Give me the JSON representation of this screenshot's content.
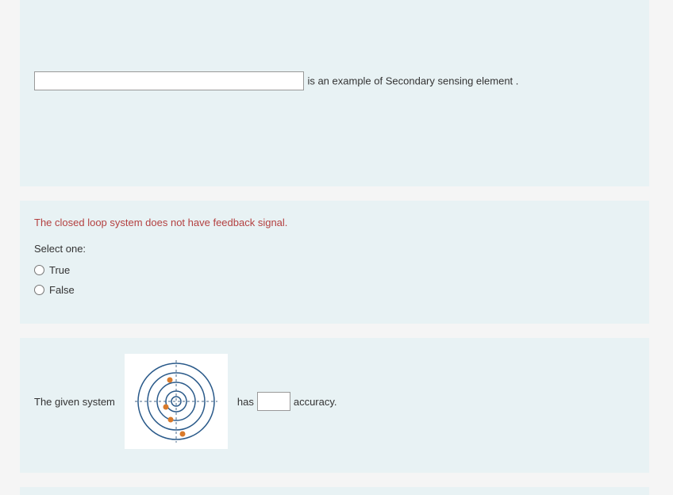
{
  "question1": {
    "suffix": " is an example of  Secondary sensing element ."
  },
  "question2": {
    "stem": "The closed loop system does not have feedback signal.",
    "prompt": "Select one:",
    "options": {
      "true": "True",
      "false": "False"
    }
  },
  "question3": {
    "prefix": "The given system",
    "mid": "has",
    "suffix": "accuracy."
  }
}
